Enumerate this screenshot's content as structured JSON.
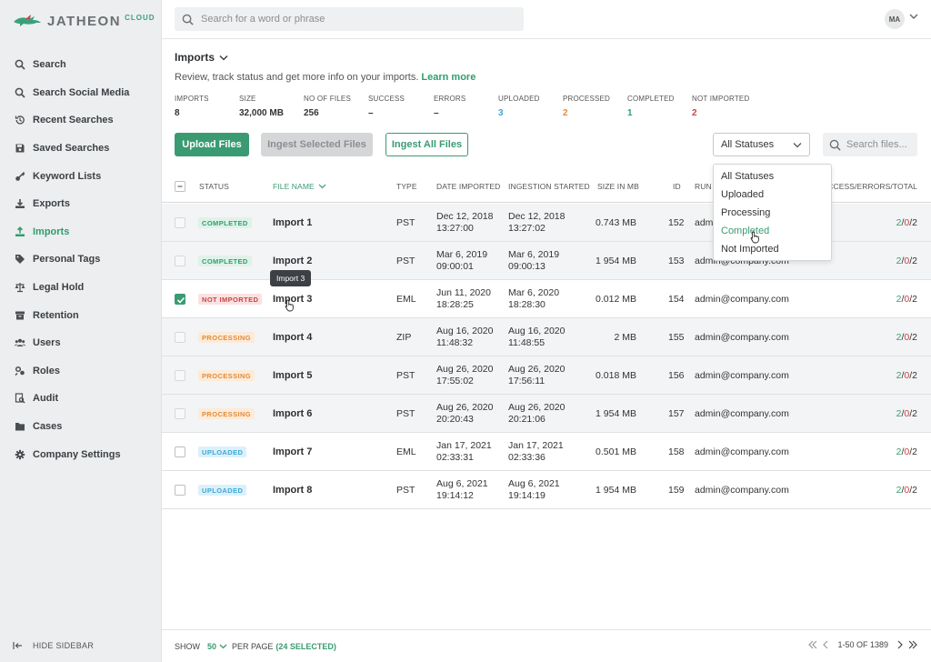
{
  "app": {
    "logo_text": "JATHEON",
    "logo_sup": "CLOUD"
  },
  "topbar": {
    "search_placeholder": "Search for a word or phrase",
    "avatar": "MA"
  },
  "sidebar": {
    "items": [
      {
        "label": "Search",
        "icon": "search-icon"
      },
      {
        "label": "Search Social Media",
        "icon": "search-icon"
      },
      {
        "label": "Recent Searches",
        "icon": "history-icon"
      },
      {
        "label": "Saved Searches",
        "icon": "save-icon"
      },
      {
        "label": "Keyword Lists",
        "icon": "key-icon"
      },
      {
        "label": "Exports",
        "icon": "download-icon"
      },
      {
        "label": "Imports",
        "icon": "upload-icon",
        "active": true
      },
      {
        "label": "Personal Tags",
        "icon": "tag-icon"
      },
      {
        "label": "Legal Hold",
        "icon": "scale-icon"
      },
      {
        "label": "Retention",
        "icon": "archive-icon"
      },
      {
        "label": "Users",
        "icon": "users-icon"
      },
      {
        "label": "Roles",
        "icon": "roles-icon"
      },
      {
        "label": "Audit",
        "icon": "audit-icon"
      },
      {
        "label": "Cases",
        "icon": "folder-icon"
      },
      {
        "label": "Company Settings",
        "icon": "gear-icon"
      }
    ],
    "hide_label": "HIDE SIDEBAR"
  },
  "page": {
    "title": "Imports",
    "description": "Review, track status and get more info on your imports.",
    "learn_more": "Learn more"
  },
  "stats": [
    {
      "label": "IMPORTS",
      "value": "8",
      "color": "#333333"
    },
    {
      "label": "SIZE",
      "value": "32,000 MB",
      "color": "#333333"
    },
    {
      "label": "NO OF FILES",
      "value": "256",
      "color": "#333333"
    },
    {
      "label": "SUCCESS",
      "value": "–",
      "color": "#333333"
    },
    {
      "label": "ERRORS",
      "value": "–",
      "color": "#333333"
    },
    {
      "label": "UPLOADED",
      "value": "3",
      "color": "#3aa8d8"
    },
    {
      "label": "PROCESSED",
      "value": "2",
      "color": "#e08c3a"
    },
    {
      "label": "COMPLETED",
      "value": "1",
      "color": "#2f9e6f"
    },
    {
      "label": "NOT IMPORTED",
      "value": "2",
      "color": "#c94444"
    }
  ],
  "actions": {
    "upload": "Upload Files",
    "ingest_selected": "Ingest Selected Files",
    "ingest_all": "Ingest All Files",
    "status_select": "All Statuses",
    "file_search_placeholder": "Search files..."
  },
  "table": {
    "headers": {
      "status": "STATUS",
      "file_name": "FILE NAME",
      "type": "TYPE",
      "date_imported": "DATE IMPORTED",
      "ingestion_started": "INGESTION STARTED",
      "size": "SIZE IN MB",
      "id": "ID",
      "run_by": "RUN",
      "set": "SUCCESS/ERRORS/TOTAL"
    },
    "rows": [
      {
        "status": "COMPLETED",
        "kind": "completed",
        "name": "Import 1",
        "type": "PST",
        "d1": "Dec 12, 2018",
        "t1": "13:27:00",
        "d2": "Dec 12, 2018",
        "t2": "13:27:02",
        "size": "0.743 MB",
        "id": "152",
        "run_by": "admin@company.com",
        "s": "2",
        "e": "0",
        "t": "2",
        "checked": false,
        "shade": true
      },
      {
        "status": "COMPLETED",
        "kind": "completed",
        "name": "Import 2",
        "type": "PST",
        "d1": "Mar 6, 2019",
        "t1": "09:00:01",
        "d2": "Mar 6, 2019",
        "t2": "09:00:13",
        "size": "1 954 MB",
        "id": "153",
        "run_by": "admin@company.com",
        "s": "2",
        "e": "0",
        "t": "2",
        "checked": false,
        "shade": true
      },
      {
        "status": "NOT IMPORTED",
        "kind": "notimported",
        "name": "Import 3",
        "type": "EML",
        "d1": "Jun 11, 2020",
        "t1": "18:28:25",
        "d2": "Mar 6, 2020",
        "t2": "18:28:30",
        "size": "0.012 MB",
        "id": "154",
        "run_by": "admin@company.com",
        "s": "2",
        "e": "0",
        "t": "2",
        "checked": true,
        "shade": false
      },
      {
        "status": "PROCESSING",
        "kind": "processing",
        "name": "Import 4",
        "type": "ZIP",
        "d1": "Aug 16, 2020",
        "t1": "11:48:32",
        "d2": "Aug 16, 2020",
        "t2": "11:48:55",
        "size": "2 MB",
        "id": "155",
        "run_by": "admin@company.com",
        "s": "2",
        "e": "0",
        "t": "2",
        "checked": false,
        "shade": true
      },
      {
        "status": "PROCESSING",
        "kind": "processing",
        "name": "Import 5",
        "type": "PST",
        "d1": "Aug 26, 2020",
        "t1": "17:55:02",
        "d2": "Aug 26, 2020",
        "t2": "17:56:11",
        "size": "0.018 MB",
        "id": "156",
        "run_by": "admin@company.com",
        "s": "2",
        "e": "0",
        "t": "2",
        "checked": false,
        "shade": true
      },
      {
        "status": "PROCESSING",
        "kind": "processing",
        "name": "Import 6",
        "type": "PST",
        "d1": "Aug 26, 2020",
        "t1": "20:20:43",
        "d2": "Aug 26, 2020",
        "t2": "20:21:06",
        "size": "1 954 MB",
        "id": "157",
        "run_by": "admin@company.com",
        "s": "2",
        "e": "0",
        "t": "2",
        "checked": false,
        "shade": true
      },
      {
        "status": "UPLOADED",
        "kind": "uploaded",
        "name": "Import 7",
        "type": "EML",
        "d1": "Jan 17, 2021",
        "t1": "02:33:31",
        "d2": "Jan 17, 2021",
        "t2": "02:33:36",
        "size": "0.501 MB",
        "id": "158",
        "run_by": "admin@company.com",
        "s": "2",
        "e": "0",
        "t": "2",
        "checked": false,
        "shade": false
      },
      {
        "status": "UPLOADED",
        "kind": "uploaded",
        "name": "Import 8",
        "type": "PST",
        "d1": "Aug 6, 2021",
        "t1": "19:14:12",
        "d2": "Aug 6, 2021",
        "t2": "19:14:19",
        "size": "1 954 MB",
        "id": "159",
        "run_by": "admin@company.com",
        "s": "2",
        "e": "0",
        "t": "2",
        "checked": false,
        "shade": false
      }
    ]
  },
  "tooltip": "Import 3",
  "dropdown": {
    "options": [
      "All Statuses",
      "Uploaded",
      "Processing",
      "Completed",
      "Not Imported"
    ],
    "highlighted": "Completed"
  },
  "footer": {
    "show": "SHOW",
    "per_page_value": "50",
    "per_page": "PER PAGE",
    "selected": "(24 SELECTED)",
    "range": "1-50 OF 1389"
  }
}
